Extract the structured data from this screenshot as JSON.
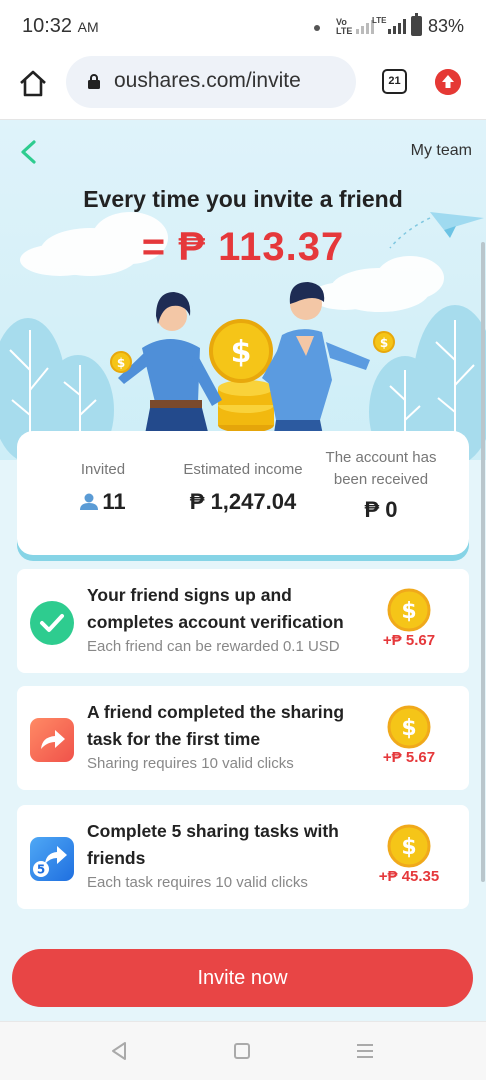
{
  "status_bar": {
    "time": "10:32",
    "ampm": "AM",
    "network": "LTE",
    "battery": "83%"
  },
  "browser": {
    "url": "oushares.com/invite",
    "tab_count": "21"
  },
  "header": {
    "my_team": "My team"
  },
  "hero": {
    "headline": "Every time you invite a friend",
    "amount": "= ₱ 113.37"
  },
  "stats": {
    "invited_label": "Invited",
    "invited_value": "11",
    "income_label": "Estimated income",
    "income_value": "₱ 1,247.04",
    "received_label": "The account has been received",
    "received_value": "₱ 0"
  },
  "tasks": [
    {
      "title": "Your friend signs up and completes account verification",
      "subtitle": "Each friend can be rewarded 0.1 USD",
      "reward": "+₱ 5.67",
      "icon": "check-icon"
    },
    {
      "title": "A friend completed the sharing task for the first time",
      "subtitle": "Sharing requires 10 valid clicks",
      "reward": "+₱ 5.67",
      "icon": "share-icon"
    },
    {
      "title": "Complete 5 sharing tasks with friends",
      "subtitle": "Each task requires 10 valid clicks",
      "reward": "+₱ 45.35",
      "icon": "share-five-icon"
    }
  ],
  "invite_button": "Invite now",
  "colors": {
    "accent_red": "#e84545",
    "amount_red": "#e5383b",
    "green": "#2ecc8f",
    "coin_gold": "#f5c518",
    "page_bg": "#e5f5fa"
  }
}
